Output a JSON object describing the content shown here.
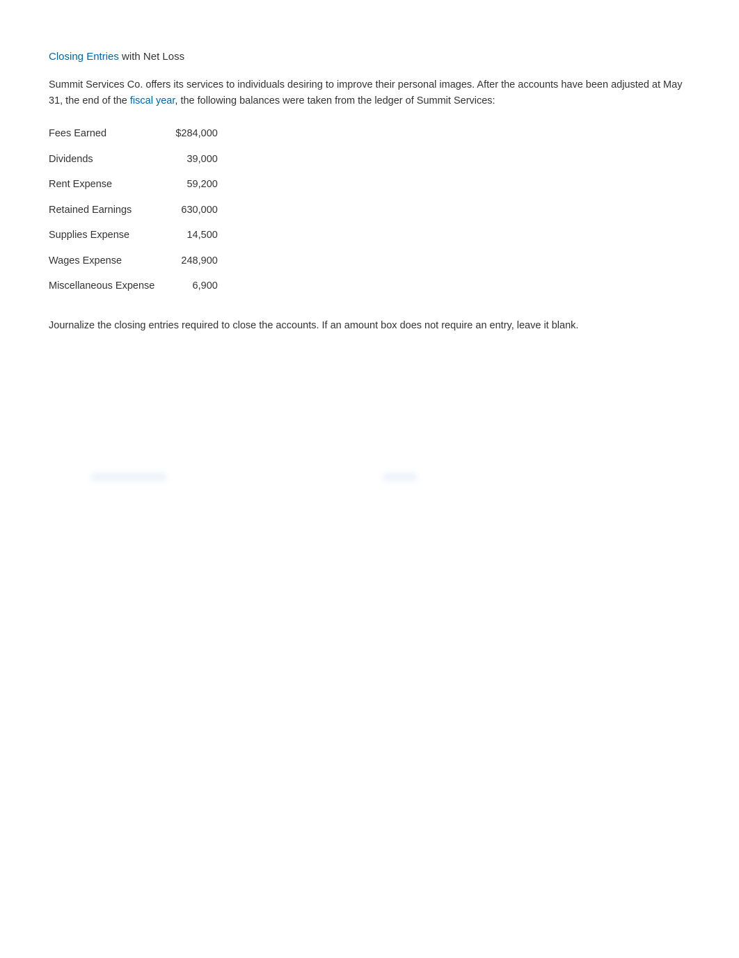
{
  "heading": {
    "term": "Closing Entries",
    "rest": " with Net Loss"
  },
  "intro": {
    "before": "Summit Services Co. offers its services to individuals desiring to improve their personal images. After the accounts have been adjusted at May 31, the end of the ",
    "term": "fiscal year",
    "after": ", the following balances were taken from the ledger of Summit Services:"
  },
  "ledger": [
    {
      "account": "Fees Earned",
      "amount": "$284,000"
    },
    {
      "account": "Dividends",
      "amount": "39,000"
    },
    {
      "account": "Rent Expense",
      "amount": "59,200"
    },
    {
      "account": "Retained Earnings",
      "amount": "630,000"
    },
    {
      "account": "Supplies Expense",
      "amount": "14,500"
    },
    {
      "account": "Wages Expense",
      "amount": "248,900"
    },
    {
      "account": "Miscellaneous Expense",
      "amount": "6,900"
    }
  ],
  "instruction": "Journalize the closing entries required to close the accounts. If an amount box does not require an entry, leave it blank."
}
